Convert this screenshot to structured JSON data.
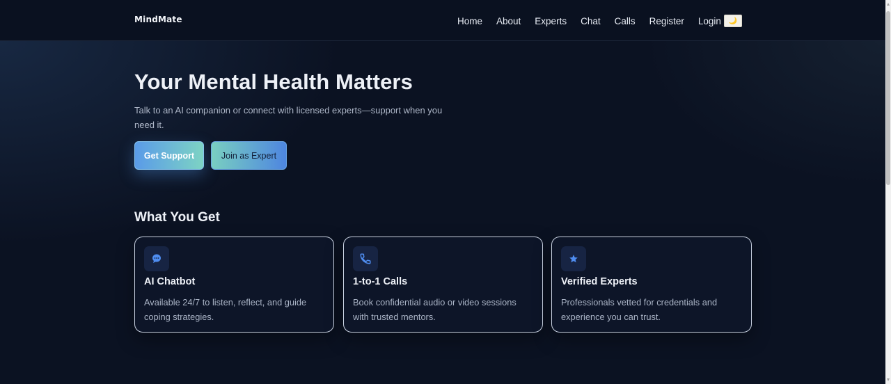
{
  "brand": "MindMate",
  "nav": {
    "links": [
      "Home",
      "About",
      "Experts",
      "Chat",
      "Calls",
      "Register",
      "Login"
    ],
    "theme_toggle_icon": "moon-icon",
    "theme_toggle_glyph": "🌙"
  },
  "hero": {
    "title": "Your Mental Health Matters",
    "subtitle": "Talk to an AI companion or connect with licensed experts—support when you need it.",
    "primary_button": "Get Support",
    "secondary_button": "Join as Expert"
  },
  "features": {
    "title": "What You Get",
    "cards": [
      {
        "icon": "chat-bubble-icon",
        "title": "AI Chatbot",
        "text": "Available 24/7 to listen, reflect, and guide coping strategies."
      },
      {
        "icon": "phone-icon",
        "title": "1-to-1 Calls",
        "text": "Book confidential audio or video sessions with trusted mentors."
      },
      {
        "icon": "star-icon",
        "title": "Verified Experts",
        "text": "Professionals vetted for credentials and experience you can trust."
      }
    ]
  },
  "colors": {
    "background": "#0b1222",
    "accent_blue": "#5a9be8",
    "accent_teal": "#7dd3c4",
    "icon_blue": "#4f8df0"
  }
}
